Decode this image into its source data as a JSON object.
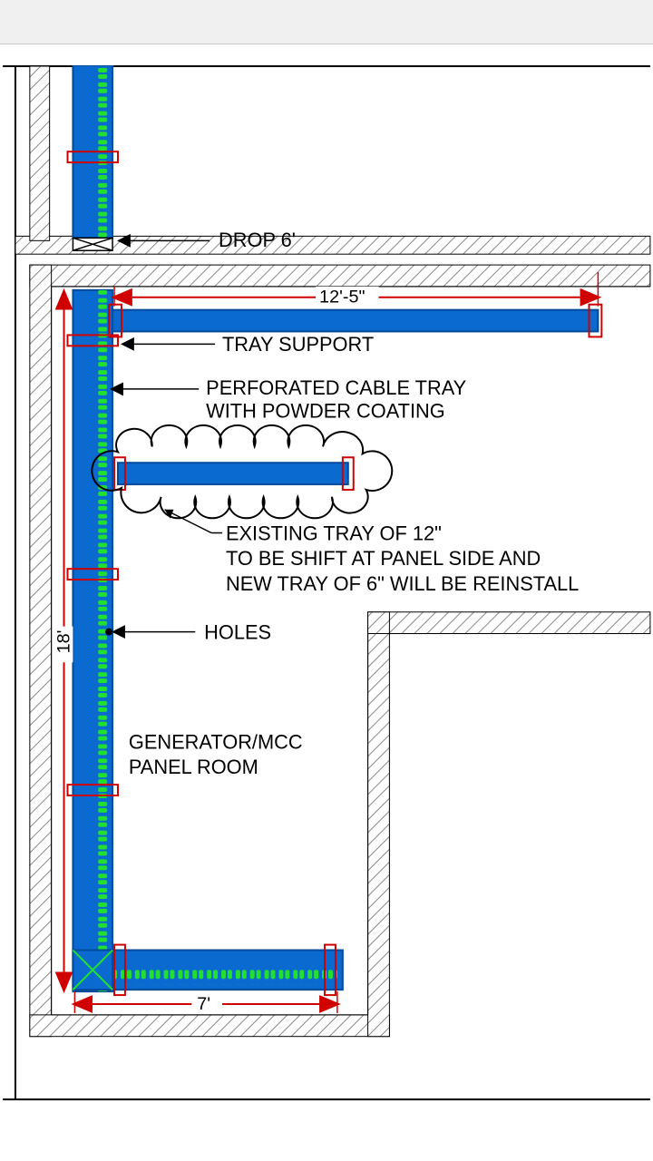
{
  "labels": {
    "drop": "DROP 6'",
    "tray_support": "TRAY SUPPORT",
    "perforated_l1": "PERFORATED CABLE TRAY",
    "perforated_l2": "WITH POWDER COATING",
    "existing_l1": "EXISTING TRAY OF 12\"",
    "existing_l2": "TO BE SHIFT AT PANEL SIDE AND",
    "existing_l3": "NEW TRAY OF 6\" WILL BE REINSTALL",
    "holes": "HOLES",
    "room": "GENERATOR/MCC",
    "room2": "PANEL ROOM"
  },
  "dimensions": {
    "top_run": "12'-5\"",
    "vertical": "18'",
    "bottom": "7'"
  },
  "colors": {
    "tray_fill": "#0a6acf",
    "tray_stroke": "#004a9a",
    "perf": "#22e02f",
    "wall": "#888"
  }
}
